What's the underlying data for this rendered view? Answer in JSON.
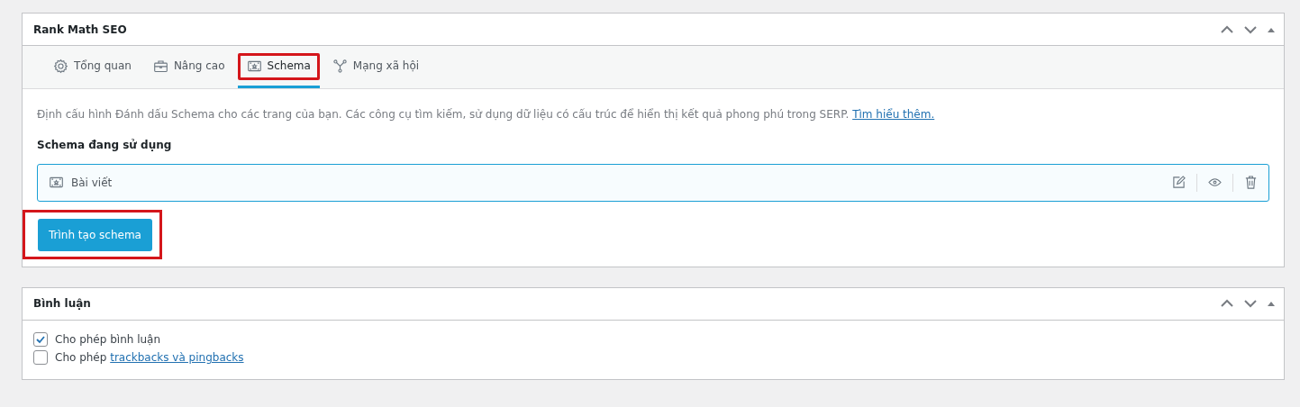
{
  "panels": [
    {
      "kind": "seo",
      "title": "Rank Math SEO",
      "tabs": [
        {
          "label": "Tổng quan",
          "selected": false,
          "highlighted": false
        },
        {
          "label": "Nâng cao",
          "selected": false,
          "highlighted": false
        },
        {
          "label": "Schema",
          "selected": true,
          "highlighted": true
        },
        {
          "label": "Mạng xã hội",
          "selected": false,
          "highlighted": false
        }
      ],
      "description": "Định cấu hình Đánh dấu Schema cho các trang của bạn. Các công cụ tìm kiếm, sử dụng dữ liệu có cấu trúc để hiển thị kết quả phong phú trong SERP.",
      "description_link": "Tìm hiểu thêm.",
      "section_title": "Schema đang sử dụng",
      "schemas": [
        {
          "label": "Bài viết"
        }
      ],
      "button": {
        "label": "Trình tạo schema",
        "highlighted": true
      }
    },
    {
      "kind": "comments",
      "title": "Bình luận",
      "options": [
        {
          "label": "Cho phép bình luận",
          "checked": true
        },
        {
          "label": "Cho phép",
          "link": "trackbacks và pingbacks",
          "checked": false
        }
      ]
    }
  ]
}
